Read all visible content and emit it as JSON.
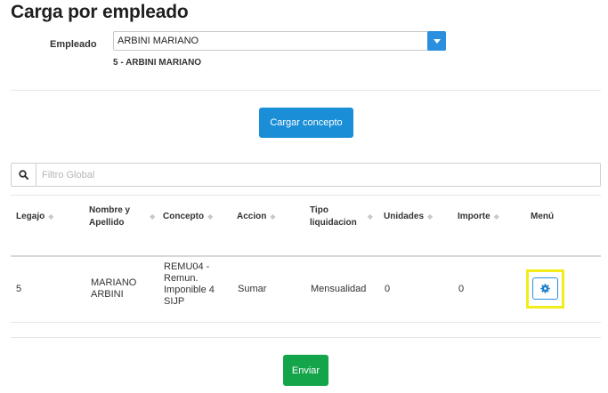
{
  "page": {
    "title": "Carga por empleado"
  },
  "employee": {
    "label": "Empleado",
    "selected": "ARBINI MARIANO",
    "sub": "5 - ARBINI MARIANO"
  },
  "actions": {
    "cargar": "Cargar concepto",
    "enviar": "Enviar"
  },
  "filter": {
    "placeholder": "Filtro Global"
  },
  "table": {
    "headers": {
      "legajo": "Legajo",
      "nombre_l1": "Nombre y",
      "nombre_l2": "Apellido",
      "concepto": "Concepto",
      "accion": "Accion",
      "tipo_l1": "Tipo",
      "tipo_l2": "liquidacion",
      "unidades": "Unidades",
      "importe": "Importe",
      "menu": "Menú"
    },
    "rows": [
      {
        "legajo": "5",
        "nombre_l1": "MARIANO",
        "nombre_l2": "ARBINI",
        "concepto_l1": "REMU04 -",
        "concepto_l2": "Remun.",
        "concepto_l3": "Imponible 4",
        "concepto_l4": "SIJP",
        "accion": "Sumar",
        "tipo": "Mensualidad",
        "unidades": "0",
        "importe": "0"
      }
    ]
  },
  "colors": {
    "primary": "#1a8ed6",
    "success": "#14a54a",
    "highlight": "#f2ec1b"
  },
  "icons": {
    "dropdown": "caret-down-icon",
    "search": "search-icon",
    "menu": "gear-icon",
    "sort": "sort-icon"
  }
}
